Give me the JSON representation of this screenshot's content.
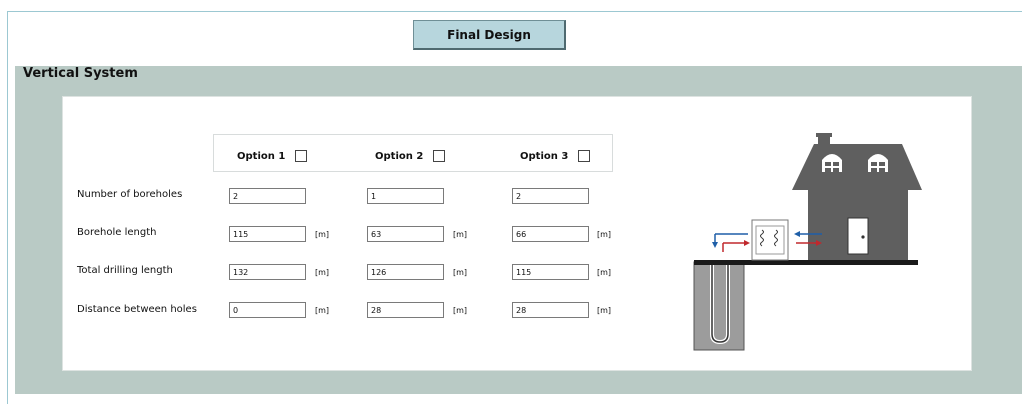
{
  "toolbar": {
    "final_design_label": "Final Design"
  },
  "section": {
    "title": "Vertical System"
  },
  "options": [
    {
      "label": "Option 1"
    },
    {
      "label": "Option 2"
    },
    {
      "label": "Option 3"
    }
  ],
  "rows": [
    {
      "label": "Number of boreholes",
      "values": [
        "2",
        "1",
        "2"
      ],
      "unit": ""
    },
    {
      "label": "Borehole length",
      "values": [
        "115",
        "63",
        "66"
      ],
      "unit": "[m]"
    },
    {
      "label": "Total drilling length",
      "values": [
        "132",
        "126",
        "115"
      ],
      "unit": "[m]"
    },
    {
      "label": "Distance between holes",
      "values": [
        "0",
        "28",
        "28"
      ],
      "unit": "[m]"
    }
  ],
  "colors": {
    "section_bg": "#b9cac5",
    "button_bg": "#b7d6dd",
    "house": "#5f5f5f",
    "arrow_blue": "#1f5fa8",
    "arrow_red": "#c0282d"
  },
  "illustration": {
    "icon": "geothermal-house-icon"
  }
}
